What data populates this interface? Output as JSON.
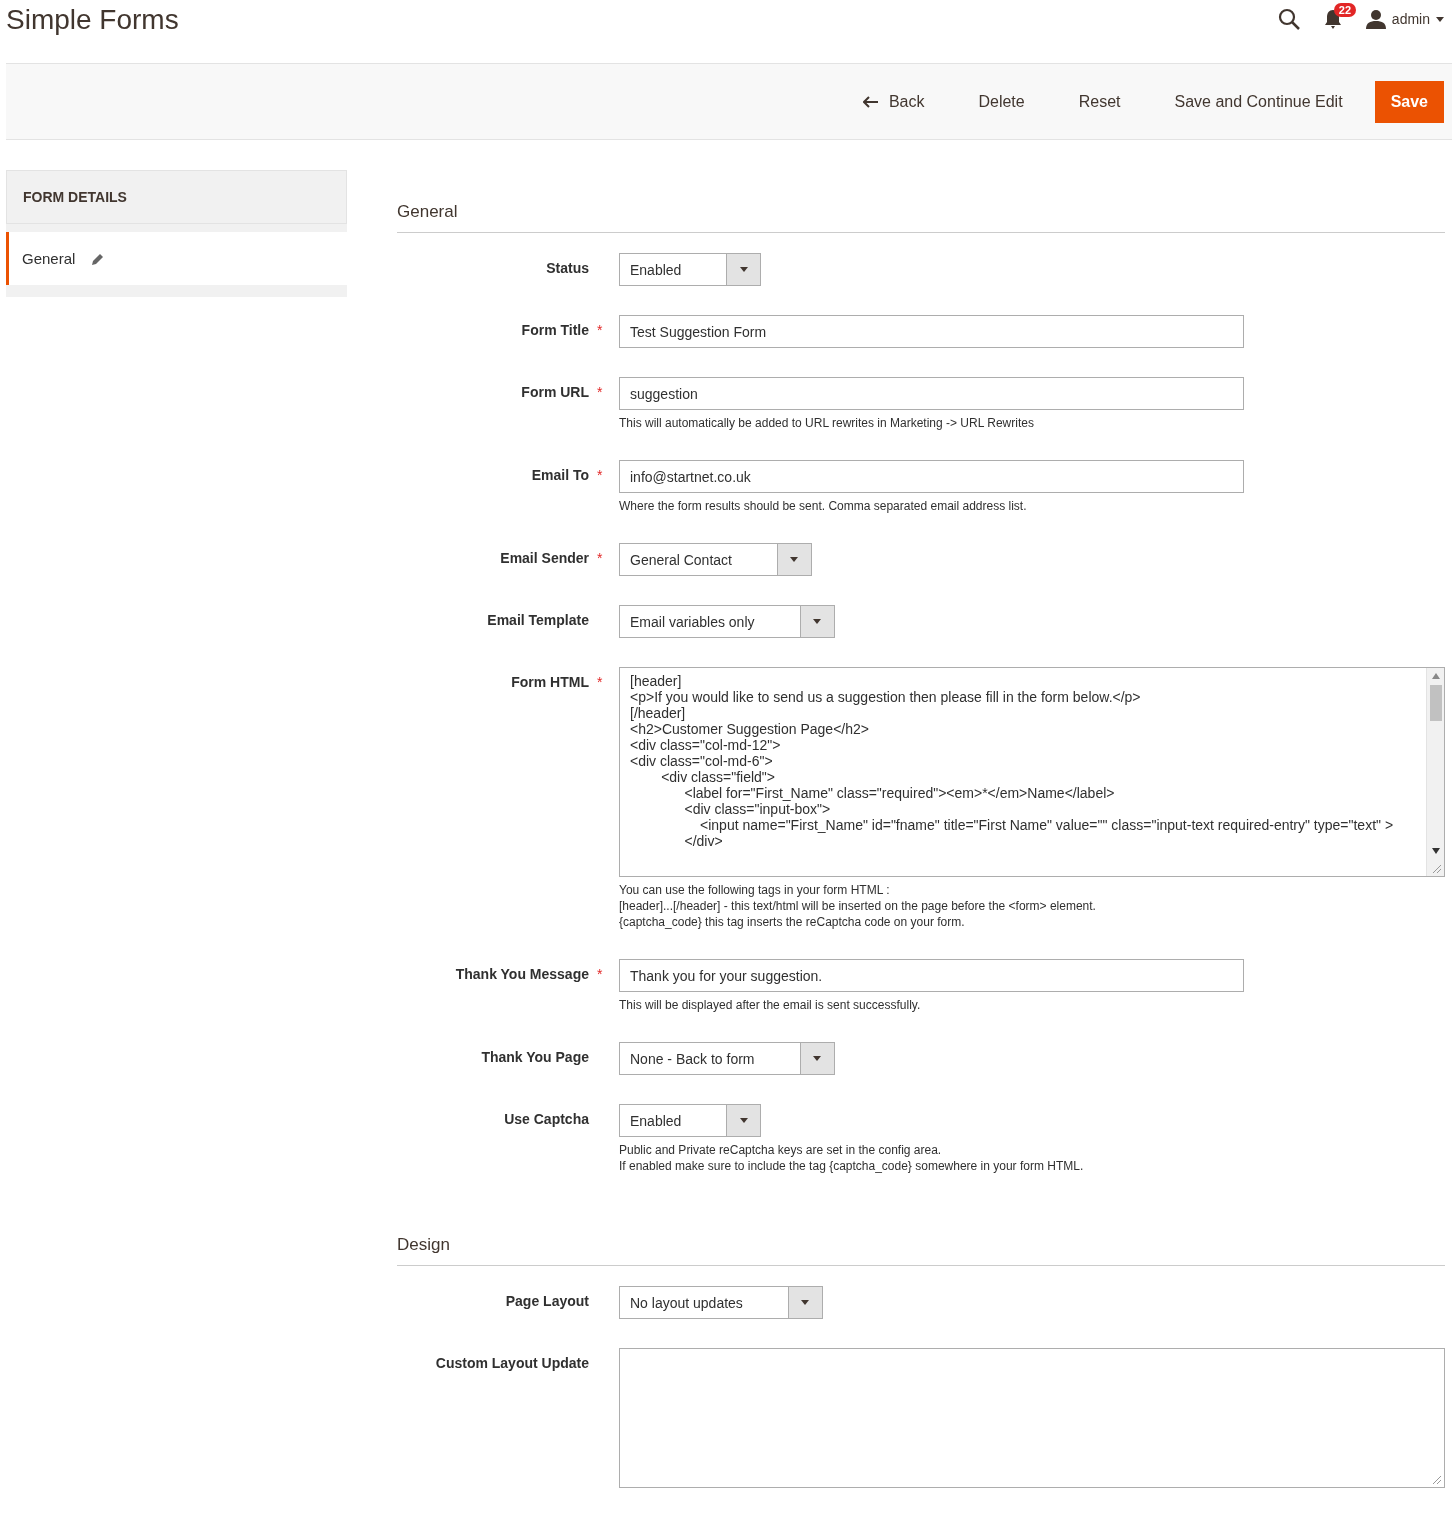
{
  "page_title": "Simple Forms",
  "header": {
    "notifications_count": "22",
    "user": "admin"
  },
  "required_marker": "*",
  "actions": [
    {
      "label": "Back",
      "kind": "back"
    },
    {
      "label": "Delete",
      "kind": "plain"
    },
    {
      "label": "Reset",
      "kind": "plain"
    },
    {
      "label": "Save and Continue Edit",
      "kind": "plain"
    },
    {
      "label": "Save",
      "kind": "primary"
    }
  ],
  "sidebar": {
    "title": "FORM DETAILS",
    "items": [
      {
        "label": "General",
        "selected": true
      }
    ]
  },
  "sections": [
    {
      "title": "General",
      "fields": [
        {
          "label": "Status",
          "kind": "select",
          "required": false,
          "value": "Enabled"
        },
        {
          "label": "Form Title",
          "kind": "text",
          "required": true,
          "value": "Test Suggestion Form"
        },
        {
          "label": "Form URL",
          "kind": "text",
          "required": true,
          "value": "suggestion",
          "notes": [
            "This will automatically be added to URL rewrites in Marketing -> URL Rewrites"
          ]
        },
        {
          "label": "Email To",
          "kind": "text",
          "required": true,
          "value": "info@startnet.co.uk",
          "notes": [
            "Where the form results should be sent. Comma separated email address list."
          ]
        },
        {
          "label": "Email Sender",
          "kind": "select",
          "required": true,
          "value": "General Contact"
        },
        {
          "label": "Email Template",
          "kind": "select",
          "required": false,
          "value": "Email variables only"
        },
        {
          "label": "Form HTML",
          "kind": "textarea",
          "required": true,
          "lines": [
            "[header]",
            "<p>If you would like to send us a suggestion then please fill in the form below.</p>",
            "[/header]",
            "<h2>Customer Suggestion Page</h2>",
            "<div class=\"col-md-12\">",
            "<div class=\"col-md-6\">",
            "\t\t<div class=\"field\">",
            "\t\t      <label for=\"First_Name\" class=\"required\"><em>*</em>Name</label>",
            "\t\t      <div class=\"input-box\">",
            "\t\t          <input name=\"First_Name\" id=\"fname\" title=\"First Name\" value=\"\" class=\"input-text required-entry\" type=\"text\" >",
            "\t\t      </div>"
          ],
          "notes": [
            "You can use the following tags in your form HTML :",
            "[header]...[/header] - this text/html will be inserted on the page before the <form> element.",
            "{captcha_code} this tag inserts the reCaptcha code on your form."
          ]
        },
        {
          "label": "Thank You Message",
          "kind": "text",
          "required": true,
          "value": "Thank you for your suggestion.",
          "notes": [
            "This will be displayed after the email is sent successfully."
          ]
        },
        {
          "label": "Thank You Page",
          "kind": "select",
          "required": false,
          "value": "None - Back to form"
        },
        {
          "label": "Use Captcha",
          "kind": "select",
          "required": false,
          "value": "Enabled",
          "notes": [
            "Public and Private reCaptcha keys are set in the config area.",
            "If enabled make sure to include the tag {captcha_code} somewhere in your form HTML."
          ]
        }
      ]
    },
    {
      "title": "Design",
      "fields": [
        {
          "label": "Page Layout",
          "kind": "select",
          "required": false,
          "value": "No layout updates"
        },
        {
          "label": "Custom Layout Update",
          "kind": "textarea",
          "required": false
        }
      ]
    }
  ]
}
